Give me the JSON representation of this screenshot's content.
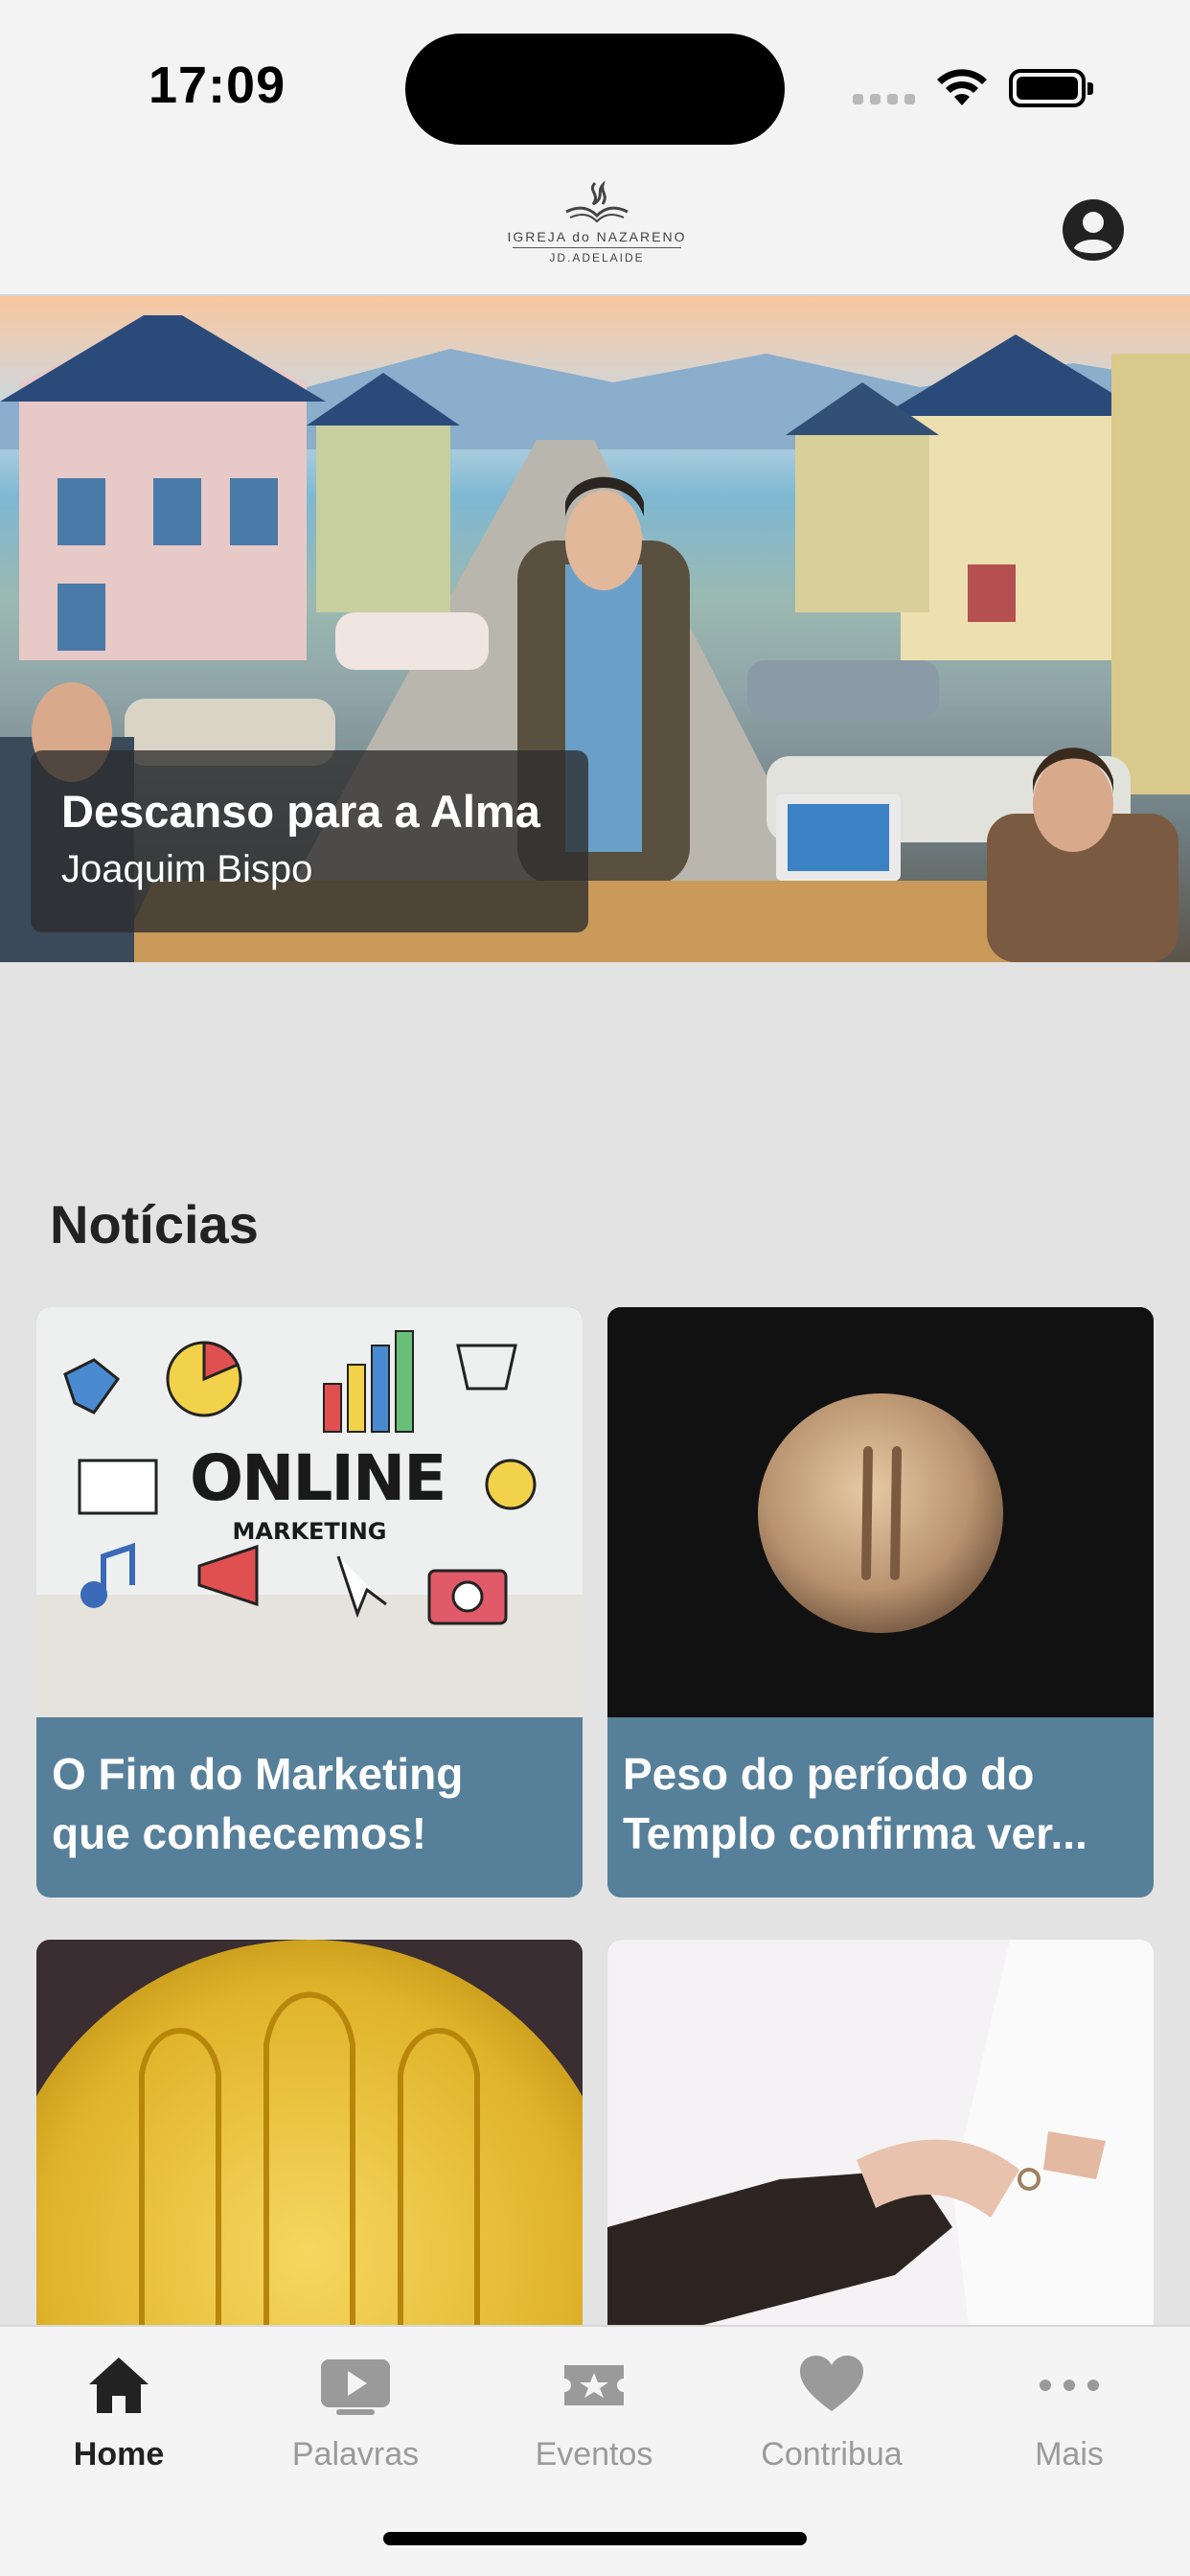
{
  "status_bar": {
    "time": "17:09"
  },
  "header": {
    "logo_name": "IGREJA do NAZARENO",
    "logo_sub": "JD.ADELAIDE"
  },
  "hero": {
    "title": "Descanso para a Alma",
    "author": "Joaquim Bispo"
  },
  "news": {
    "section_title": "Notícias",
    "cards": [
      {
        "line1": "O Fim do Marketing",
        "line2": "que conhecemos!",
        "image_text": "ONLINE",
        "image_subtext": "MARKETING"
      },
      {
        "line1": "Peso do período do",
        "line2": "Templo confirma ver..."
      },
      {
        "line1": "",
        "line2": ""
      },
      {
        "line1": "",
        "line2": ""
      }
    ]
  },
  "tabbar": {
    "tabs": [
      {
        "label": "Home",
        "icon": "home-icon",
        "active": true
      },
      {
        "label": "Palavras",
        "icon": "play-icon",
        "active": false
      },
      {
        "label": "Eventos",
        "icon": "star-ticket-icon",
        "active": false
      },
      {
        "label": "Contribua",
        "icon": "heart-icon",
        "active": false
      },
      {
        "label": "Mais",
        "icon": "more-icon",
        "active": false
      }
    ]
  },
  "colors": {
    "card_caption": "#567f9a",
    "background": "#e3e3e3",
    "tab_active": "#222222",
    "tab_inactive": "#9a9a9a"
  }
}
